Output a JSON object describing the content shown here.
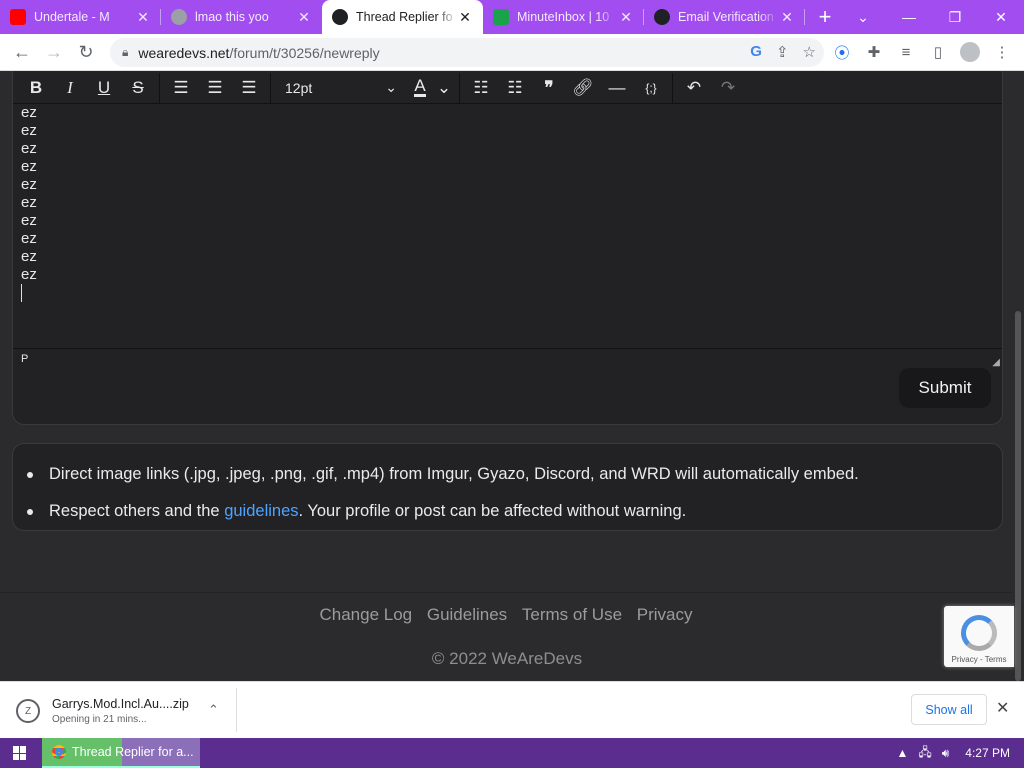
{
  "tabs": [
    {
      "title": "Undertale - M",
      "favicon": "youtube-icon",
      "color": "#ff0000"
    },
    {
      "title": "lmao this yoo",
      "favicon": "globe-icon",
      "color": "#9aa0a6"
    },
    {
      "title": "Thread Replier fo",
      "favicon": "wrd-icon",
      "color": "#202124",
      "active": true
    },
    {
      "title": "MinuteInbox | 10",
      "favicon": "check-icon",
      "color": "#1aa34a"
    },
    {
      "title": "Email Verification",
      "favicon": "wrd-icon",
      "color": "#202124"
    }
  ],
  "address": {
    "host": "wearedevs.net",
    "path": "/forum/t/30256/newreply"
  },
  "editor": {
    "font_size": "12pt",
    "lines": [
      "ez",
      "ez",
      "ez",
      "ez",
      "ez",
      "ez",
      "ez",
      "ez",
      "ez",
      "ez"
    ],
    "status_path": "P",
    "submit_label": "Submit"
  },
  "notes": {
    "item1": "Direct image links (.jpg, .jpeg, .png, .gif, .mp4) from Imgur, Gyazo, Discord, and WRD will automatically embed.",
    "item2_before": "Respect others and the ",
    "item2_link": "guidelines",
    "item2_after": ". Your profile or post can be affected without warning."
  },
  "footer": {
    "links": [
      "Change Log",
      "Guidelines",
      "Terms of Use",
      "Privacy"
    ],
    "copyright": "© 2022 WeAreDevs"
  },
  "recaptcha": {
    "text": "Privacy - Terms"
  },
  "download": {
    "filename": "Garrys.Mod.Incl.Au....zip",
    "status": "Opening in 21 mins...",
    "show_all": "Show all"
  },
  "taskbar": {
    "app_title": "Thread Replier for a...",
    "time": "4:27 PM"
  },
  "colors": {
    "accent": "#a24df0",
    "link": "#4da3ff",
    "taskbar": "#5a2d8f"
  }
}
